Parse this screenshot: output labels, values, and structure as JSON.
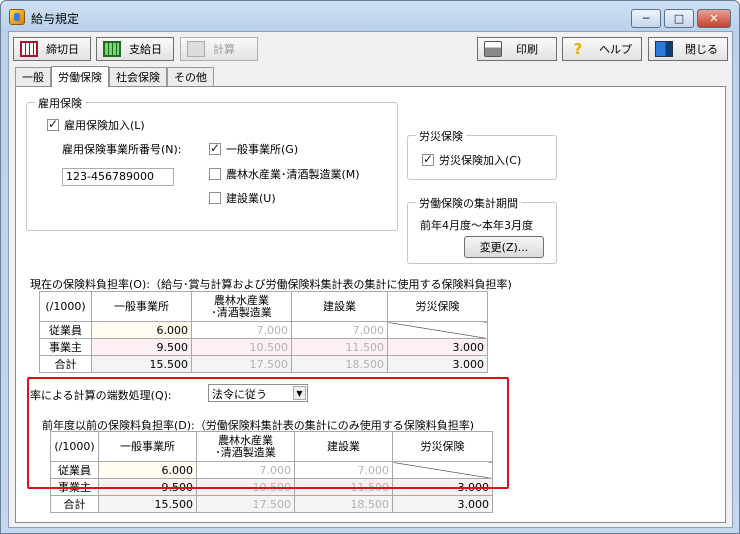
{
  "window": {
    "title": "給与規定",
    "min": "─",
    "max": "□",
    "close": "✕"
  },
  "toolbar": {
    "shime": "締切日",
    "shikyu": "支給日",
    "keisan": "計算",
    "print": "印刷",
    "help": "ヘルプ",
    "close": "閉じる"
  },
  "tabs": [
    "一般",
    "労働保険",
    "社会保険",
    "その他"
  ],
  "koyou": {
    "title": "雇用保険",
    "join_label": "雇用保険加入(L)",
    "join_checked": true,
    "office_no_label": "雇用保険事業所番号(N):",
    "office_no_value": "123-456789000",
    "opt_general": "一般事業所(G)",
    "opt_general_checked": true,
    "opt_agri": "農林水産業･清酒製造業(M)",
    "opt_agri_checked": false,
    "opt_const": "建設業(U)",
    "opt_const_checked": false
  },
  "rousai": {
    "title": "労災保険",
    "join_label": "労災保険加入(C)",
    "join_checked": true
  },
  "period": {
    "title": "労働保険の集計期間",
    "value": "前年4月度～本年3月度",
    "change_label": "変更(Z)..."
  },
  "current": {
    "title": "現在の保険料負担率(O):（給与･賞与計算および労働保険料集計表の集計に使用する保険料負担率)",
    "headers": [
      "(/1000)",
      "一般事業所",
      "農林水産業\n･清酒製造業",
      "建設業",
      "労災保険"
    ],
    "rows": [
      {
        "label": "従業員",
        "vals": [
          "6.000",
          "7.000",
          "7.000",
          ""
        ]
      },
      {
        "label": "事業主",
        "vals": [
          "9.500",
          "10.500",
          "11.500",
          "3.000"
        ]
      },
      {
        "label": "合計",
        "vals": [
          "15.500",
          "17.500",
          "18.500",
          "3.000"
        ]
      }
    ]
  },
  "rounding": {
    "label": "率による計算の端数処理(Q):",
    "value": "法令に従う",
    "arrow": "▼"
  },
  "prior": {
    "title": "前年度以前の保険料負担率(D):（労働保険料集計表の集計にのみ使用する保険料負担率)",
    "headers": [
      "(/1000)",
      "一般事業所",
      "農林水産業\n･清酒製造業",
      "建設業",
      "労災保険"
    ],
    "rows": [
      {
        "label": "従業員",
        "vals": [
          "6.000",
          "7.000",
          "7.000",
          ""
        ]
      },
      {
        "label": "事業主",
        "vals": [
          "9.500",
          "10.500",
          "11.500",
          "3.000"
        ]
      },
      {
        "label": "合計",
        "vals": [
          "15.500",
          "17.500",
          "18.500",
          "3.000"
        ]
      }
    ]
  }
}
